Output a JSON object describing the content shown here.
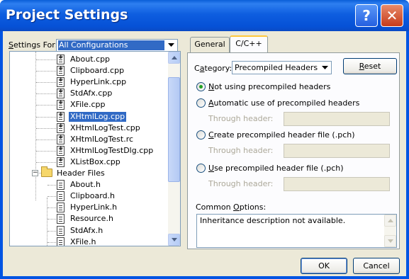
{
  "window": {
    "title": "Project Settings"
  },
  "titlebar_buttons": {
    "help": "?",
    "close": "✕"
  },
  "settings_for": {
    "label": "Settings For:",
    "value": "All Configurations"
  },
  "tree": {
    "items": [
      {
        "label": "About.cpp",
        "type": "source"
      },
      {
        "label": "Clipboard.cpp",
        "type": "source"
      },
      {
        "label": "HyperLink.cpp",
        "type": "source"
      },
      {
        "label": "StdAfx.cpp",
        "type": "source"
      },
      {
        "label": "XFile.cpp",
        "type": "source"
      },
      {
        "label": "XHtmlLog.cpp",
        "type": "source",
        "selected": true
      },
      {
        "label": "XHtmlLogTest.cpp",
        "type": "source"
      },
      {
        "label": "XHtmlLogTest.rc",
        "type": "source"
      },
      {
        "label": "XHtmlLogTestDlg.cpp",
        "type": "source"
      },
      {
        "label": "XListBox.cpp",
        "type": "source"
      },
      {
        "label": "Header Files",
        "type": "folder"
      },
      {
        "label": "About.h",
        "type": "header"
      },
      {
        "label": "Clipboard.h",
        "type": "header"
      },
      {
        "label": "HyperLink.h",
        "type": "header"
      },
      {
        "label": "Resource.h",
        "type": "header"
      },
      {
        "label": "StdAfx.h",
        "type": "header"
      },
      {
        "label": "XFile.h",
        "type": "header"
      }
    ]
  },
  "tabs": [
    {
      "label": "General",
      "active": false
    },
    {
      "label": "C/C++",
      "active": true
    }
  ],
  "category": {
    "label": "Category:",
    "value": "Precompiled Headers"
  },
  "reset_button": "Reset",
  "options": [
    {
      "label": "Not using precompiled headers",
      "checked": true,
      "through": false
    },
    {
      "label": "Automatic use of precompiled headers",
      "checked": false,
      "through": true
    },
    {
      "label": "Create precompiled header file (.pch)",
      "checked": false,
      "through": true
    },
    {
      "label": "Use precompiled header file (.pch)",
      "checked": false,
      "through": true
    }
  ],
  "through_header_label": "Through header:",
  "common_options": {
    "label": "Common Options:",
    "text": "Inheritance description not available."
  },
  "buttons": {
    "ok": "OK",
    "cancel": "Cancel"
  },
  "colors": {
    "title_bar": "#0054e3",
    "selection": "#316ac5",
    "face": "#ece9d8"
  }
}
